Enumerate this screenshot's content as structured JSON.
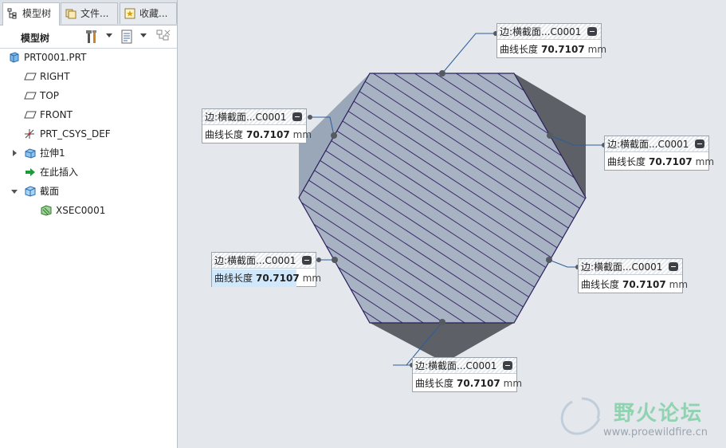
{
  "tabs": [
    {
      "label": "模型树",
      "icon": "model-tree-icon"
    },
    {
      "label": "文件...",
      "icon": "folder-browser-icon"
    },
    {
      "label": "收藏...",
      "icon": "favorites-icon"
    }
  ],
  "toolbar": {
    "title": "模型树",
    "settings_icon": "tools-icon",
    "show_icon": "list-settings-icon",
    "filter_icon": "tree-filter-icon"
  },
  "tree": {
    "root": "PRT0001.PRT",
    "items": [
      {
        "label": "RIGHT",
        "icon": "datum-plane-icon"
      },
      {
        "label": "TOP",
        "icon": "datum-plane-icon"
      },
      {
        "label": "FRONT",
        "icon": "datum-plane-icon"
      },
      {
        "label": "PRT_CSYS_DEF",
        "icon": "coordinate-system-icon"
      },
      {
        "label": "拉伸1",
        "icon": "extrude-icon"
      },
      {
        "label": "在此插入",
        "icon": "insert-here-icon"
      },
      {
        "label": "截面",
        "icon": "section-icon"
      },
      {
        "label": "XSEC0001",
        "icon": "xsection-icon"
      }
    ]
  },
  "callouts": [
    {
      "title": "边:横截面...C0001",
      "label": "曲线长度",
      "value": "70.7107",
      "unit": "mm"
    },
    {
      "title": "边:横截面...C0001",
      "label": "曲线长度",
      "value": "70.7107",
      "unit": "mm"
    },
    {
      "title": "边:横截面...C0001",
      "label": "曲线长度",
      "value": "70.7107",
      "unit": "mm"
    },
    {
      "title": "边:横截面...C0001",
      "label": "曲线长度",
      "value": "70.7107",
      "unit": "mm"
    },
    {
      "title": "边:横截面...C0001",
      "label": "曲线长度",
      "value": "70.7107",
      "unit": "mm"
    },
    {
      "title": "边:横截面...C0001",
      "label": "曲线长度",
      "value": "70.7107",
      "unit": "mm"
    }
  ],
  "watermark": {
    "cn": "野火论坛",
    "en": "www.proewildfire.cn"
  },
  "colors": {
    "hatch": "#3a2a6e",
    "face_light": "#9aa7b8",
    "face_dark": "#5d6066",
    "selection": "#cfe8fc"
  }
}
